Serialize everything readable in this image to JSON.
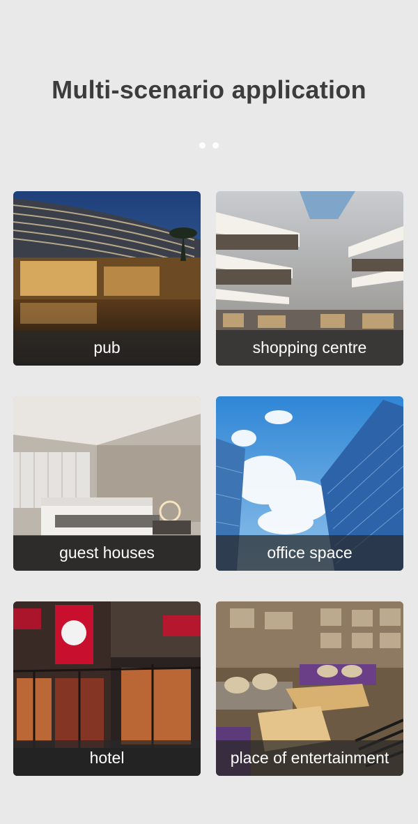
{
  "title": "Multi-scenario application",
  "carousel": {
    "dot_count": 2,
    "dot_color": "#ffffff"
  },
  "scenarios": [
    {
      "label": "pub",
      "image": "hotel-building-night-photo"
    },
    {
      "label": "shopping centre",
      "image": "mall-atrium-photo"
    },
    {
      "label": "guest houses",
      "image": "bedroom-interior-photo"
    },
    {
      "label": "office space",
      "image": "glass-skyscrapers-sky-photo"
    },
    {
      "label": "hotel",
      "image": "kfc-restaurant-storefront-photo"
    },
    {
      "label": "place of entertainment",
      "image": "lounge-bar-interior-photo"
    }
  ],
  "colors": {
    "background": "#e9e9e9",
    "title": "#3c3c3c",
    "caption_bar": "rgba(40,40,40,0.72)",
    "caption_text": "#ffffff"
  }
}
